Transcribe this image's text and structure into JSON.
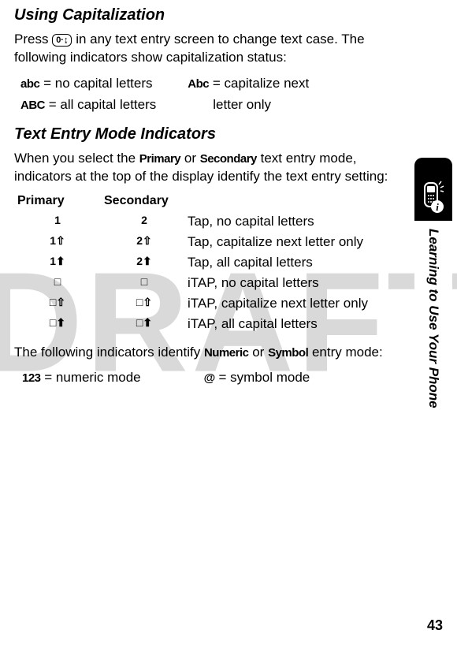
{
  "watermark": "DRAFT",
  "side_label": "Learning to Use Your Phone",
  "page_number": "43",
  "section1": {
    "heading": "Using Capitalization",
    "para_a": "Press ",
    "para_b": " in any text entry screen to change text case. The following indicators show capitalization status:",
    "key_label": "0·↨",
    "cap": {
      "abc": "abc",
      "abc_desc": " = no capital letters",
      "ABC": "ABC",
      "ABC_desc": " = all capital letters",
      "Abc": "Abc",
      "Abc_desc_l1": " = capitalize next",
      "Abc_desc_l2": "letter only"
    }
  },
  "section2": {
    "heading": "Text Entry Mode Indicators",
    "para_a": "When you select the ",
    "para_b": " or ",
    "para_c": " text entry mode, indicators at the top of the display identify the text entry setting:",
    "primary_word": "Primary",
    "secondary_word": "Secondary",
    "table": {
      "head_primary": "Primary",
      "head_secondary": "Secondary",
      "rows": [
        {
          "p": "1",
          "s": "2",
          "desc": "Tap, no capital letters"
        },
        {
          "p": "1⇧",
          "s": "2⇧",
          "desc": "Tap, capitalize next letter only"
        },
        {
          "p": "1⬆",
          "s": "2⬆",
          "desc": "Tap, all capital letters"
        },
        {
          "p": "□",
          "s": "□",
          "desc": "iTAP, no capital letters"
        },
        {
          "p": "□⇧",
          "s": "□⇧",
          "desc": "iTAP, capitalize next letter only"
        },
        {
          "p": "□⬆",
          "s": "□⬆",
          "desc": "iTAP, all capital letters"
        }
      ]
    },
    "para2_a": "The following indicators identify ",
    "para2_b": " or ",
    "para2_c": " entry mode:",
    "numeric_word": "Numeric",
    "symbol_word": "Symbol",
    "modes": {
      "num_ind": "123",
      "num_desc": " = numeric mode",
      "sym_ind": "@",
      "sym_desc": " = symbol mode"
    }
  }
}
